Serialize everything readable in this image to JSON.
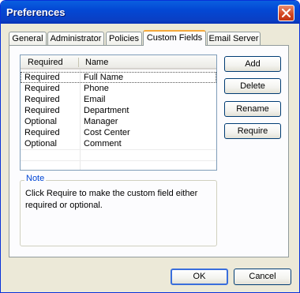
{
  "window": {
    "title": "Preferences"
  },
  "tabs": [
    {
      "label": "General"
    },
    {
      "label": "Administrator"
    },
    {
      "label": "Policies"
    },
    {
      "label": "Custom Fields"
    },
    {
      "label": "Email Server"
    }
  ],
  "active_tab": "Custom Fields",
  "fields_table": {
    "columns": [
      "Required",
      "Name"
    ],
    "rows": [
      {
        "required": "Required",
        "name": "Full Name"
      },
      {
        "required": "Required",
        "name": "Phone"
      },
      {
        "required": "Required",
        "name": "Email"
      },
      {
        "required": "Required",
        "name": "Department"
      },
      {
        "required": "Optional",
        "name": "Manager"
      },
      {
        "required": "Required",
        "name": "Cost Center"
      },
      {
        "required": "Optional",
        "name": "Comment"
      }
    ]
  },
  "side_buttons": {
    "add": "Add",
    "delete": "Delete",
    "rename": "Rename",
    "require": "Require"
  },
  "note": {
    "title": "Note",
    "text": "Click Require to make the custom field either required or optional."
  },
  "footer": {
    "ok": "OK",
    "cancel": "Cancel"
  },
  "colors": {
    "titlebar": "#0a5fe0",
    "active_tab_accent": "#f6a93b",
    "note_title": "#0046d5"
  }
}
